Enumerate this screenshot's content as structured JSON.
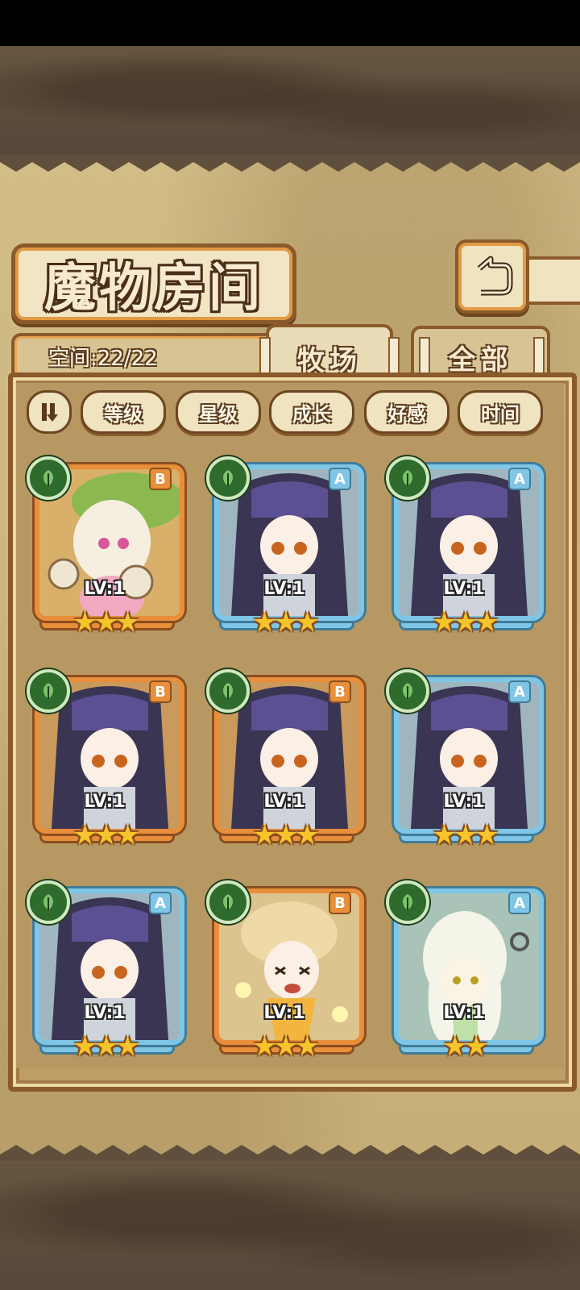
{
  "title": "魔物房间",
  "space": {
    "label": "空间:22/22"
  },
  "tabs": [
    {
      "label": "牧场",
      "active": true
    },
    {
      "label": "全部",
      "active": false
    }
  ],
  "sort": {
    "toggle_icon": "sort-order-icon",
    "buttons": [
      "等级",
      "星级",
      "成长",
      "好感",
      "时间"
    ]
  },
  "colors": {
    "frame_brown": "#8a5a2b",
    "rarity_orange": "#e98e3a",
    "rarity_blue": "#7fc6e6",
    "element_green": "#2e6b2c",
    "star_gold": "#f7c52b"
  },
  "monsters": [
    {
      "rank": "B",
      "level": "LV:1",
      "stars": "★★★",
      "frame": "orange",
      "element": "leaf-icon",
      "portrait": "lotus-girl"
    },
    {
      "rank": "A",
      "level": "LV:1",
      "stars": "★★★",
      "frame": "blue",
      "element": "leaf-icon",
      "portrait": "dark-hair-girl"
    },
    {
      "rank": "A",
      "level": "LV:1",
      "stars": "★★★",
      "frame": "blue",
      "element": "leaf-icon",
      "portrait": "dark-hair-girl"
    },
    {
      "rank": "B",
      "level": "LV:1",
      "stars": "★★★",
      "frame": "orange",
      "element": "leaf-icon",
      "portrait": "dark-hair-girl"
    },
    {
      "rank": "B",
      "level": "LV:1",
      "stars": "★★★",
      "frame": "orange",
      "element": "leaf-icon",
      "portrait": "dark-hair-girl"
    },
    {
      "rank": "A",
      "level": "LV:1",
      "stars": "★★★",
      "frame": "blue",
      "element": "leaf-icon",
      "portrait": "dark-hair-girl"
    },
    {
      "rank": "A",
      "level": "LV:1",
      "stars": "★★★",
      "frame": "blue",
      "element": "leaf-icon",
      "portrait": "dark-hair-girl"
    },
    {
      "rank": "B",
      "level": "LV:1",
      "stars": "★★★",
      "frame": "orange",
      "element": "leaf-icon",
      "portrait": "golden-fairy"
    },
    {
      "rank": "A",
      "level": "LV:1",
      "stars": "★★",
      "frame": "blue",
      "element": "leaf-icon",
      "portrait": "onion-girl"
    }
  ]
}
